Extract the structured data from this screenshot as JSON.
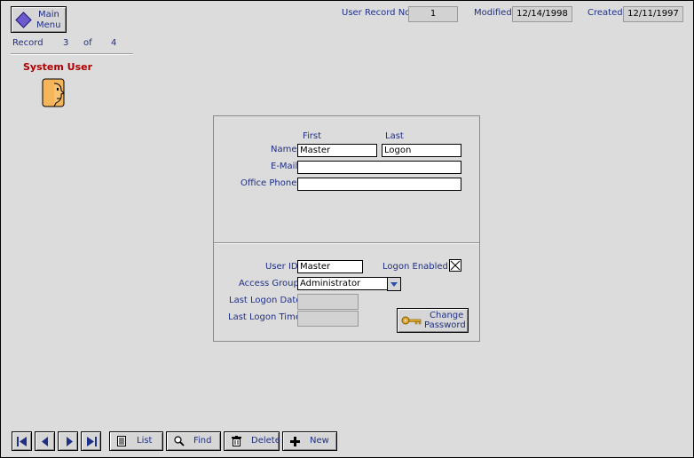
{
  "header": {
    "main_menu_label_line1": "Main",
    "main_menu_label_line2": "Menu",
    "record_label": "Record",
    "record_current": "3",
    "record_of": "of",
    "record_total": "4",
    "user_record_no_label": "User Record No",
    "user_record_no": "1",
    "modified_label": "Modified",
    "modified_date": "12/14/1998",
    "created_label": "Created",
    "created_date": "12/11/1997",
    "section_title": "System User"
  },
  "form": {
    "first_heading": "First",
    "last_heading": "Last",
    "name_label": "Name",
    "first_name": "Master",
    "last_name": "Logon",
    "email_label": "E-Mail",
    "email": "",
    "office_phone_label": "Office Phone",
    "office_phone": "",
    "user_id_label": "User ID",
    "user_id": "Master",
    "logon_enabled_label": "Logon Enabled",
    "logon_enabled": true,
    "access_group_label": "Access Group",
    "access_group": "Administrator",
    "last_logon_date_label": "Last Logon Date",
    "last_logon_date": "",
    "last_logon_time_label": "Last Logon Time",
    "last_logon_time": "",
    "change_password_line1": "Change",
    "change_password_line2": "Password"
  },
  "toolbar": {
    "list_label": "List",
    "find_label": "Find",
    "delete_label": "Delete",
    "new_label": "New"
  },
  "colors": {
    "background": "#dcdcdc",
    "label_text": "#1f2f86",
    "section_title": "#b00000",
    "button_face": "#d6d6d6"
  }
}
